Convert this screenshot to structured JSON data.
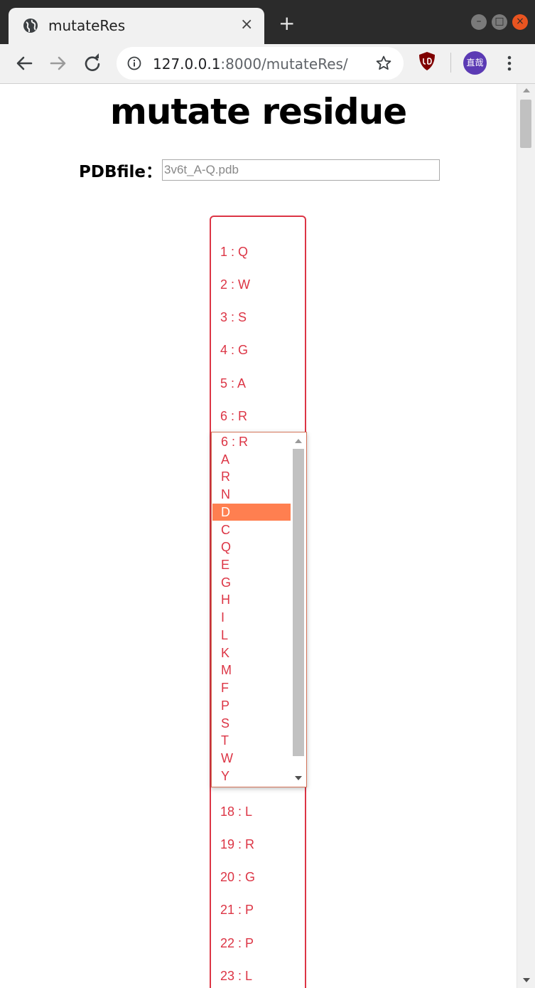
{
  "browser": {
    "tab_title": "mutateRes",
    "new_tab_symbol": "+",
    "close_symbol": "×",
    "url_host": "127.0.0.1",
    "url_path": ":8000/mutateRes/",
    "avatar_text": "直哉",
    "window_buttons": {
      "minimize": "–",
      "maximize": "□",
      "close": "×"
    }
  },
  "page": {
    "title": "mutate residue",
    "pdb_label": "PDBfile：",
    "pdb_placeholder": "3v6t_A-Q.pdb"
  },
  "residues_above": [
    "1 : Q",
    "2 : W",
    "3 : S",
    "4 : G",
    "5 : A",
    "6 : R"
  ],
  "residues_below": [
    "18 : L",
    "19 : R",
    "20 : G",
    "21 : P",
    "22 : P",
    "23 : L"
  ],
  "dropdown": {
    "options": [
      "6 : R",
      "A",
      "R",
      "N",
      "D",
      "C",
      "Q",
      "E",
      "G",
      "H",
      "I",
      "L",
      "K",
      "M",
      "F",
      "P",
      "S",
      "T",
      "W",
      "Y"
    ],
    "highlighted": "D"
  },
  "colors": {
    "accent": "#dc3545",
    "highlight": "#ff7f50"
  }
}
